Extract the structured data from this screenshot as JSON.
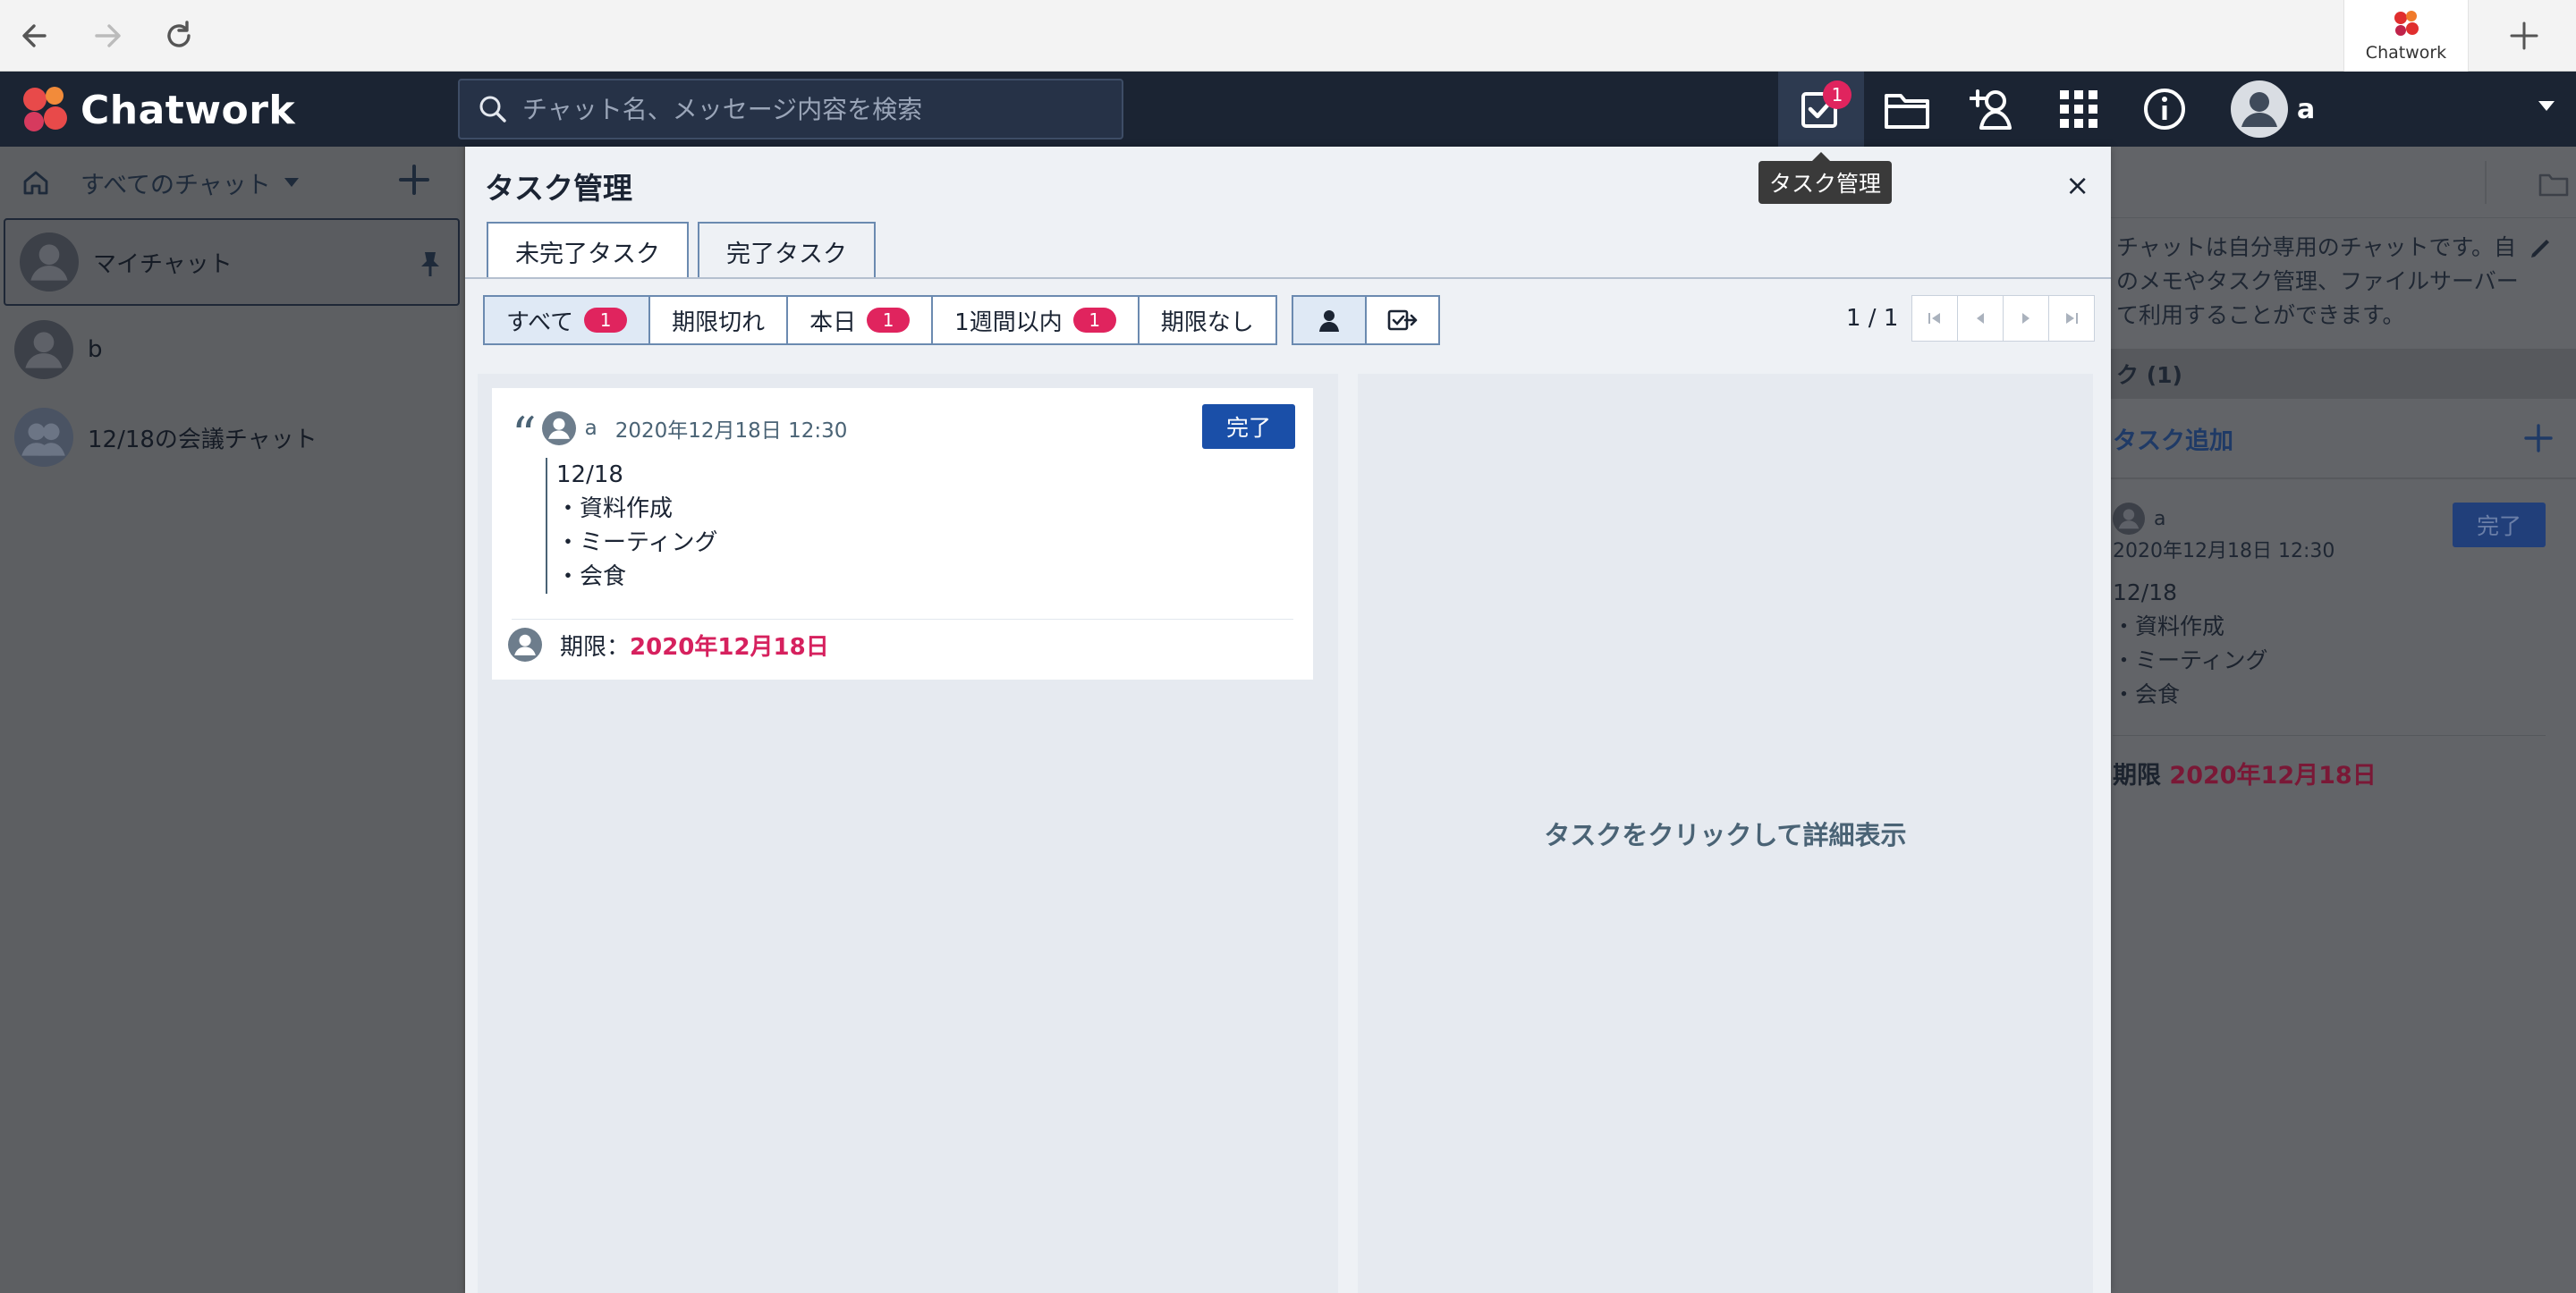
{
  "browser": {
    "tab_title": "Chatwork"
  },
  "header": {
    "logo_text": "Chatwork",
    "search_placeholder": "チャット名、メッセージ内容を検索",
    "task_badge": "1",
    "user_name": "a"
  },
  "tooltip": "タスク管理",
  "sidebar": {
    "filter_label": "すべてのチャット",
    "rooms": [
      {
        "name": "マイチャット"
      },
      {
        "name": "b"
      },
      {
        "name": "12/18の会議チャット"
      }
    ]
  },
  "right_panel": {
    "description": "チャットは自分専用のチャットです。自のメモやタスク管理、ファイルサーバーて利用することができます。",
    "desc_lines": [
      "チャットは自分専用のチャットです。自",
      "のメモやタスク管理、ファイルサーバー",
      "て利用することができます。"
    ],
    "section_title": "ク (1)",
    "add_task_label": "タスク追加",
    "task": {
      "user": "a",
      "time": "2020年12月18日 12:30",
      "done_label": "完了",
      "lines": [
        "12/18",
        "・資料作成",
        "・ミーティング",
        "・会食"
      ],
      "due_label": "期限",
      "due_date": "2020年12月18日"
    }
  },
  "modal": {
    "title": "タスク管理",
    "close": "×",
    "tabs": [
      {
        "label": "未完了タスク",
        "active": true
      },
      {
        "label": "完了タスク",
        "active": false
      }
    ],
    "filters": [
      {
        "label": "すべて",
        "count": "1"
      },
      {
        "label": "期限切れ",
        "count": ""
      },
      {
        "label": "本日",
        "count": "1"
      },
      {
        "label": "1週間以内",
        "count": "1"
      },
      {
        "label": "期限なし",
        "count": ""
      }
    ],
    "pager": "1 / 1",
    "detail_hint": "タスクをクリックして詳細表示",
    "task": {
      "user": "a",
      "time": "2020年12月18日 12:30",
      "done_label": "完了",
      "lines": [
        "12/18",
        "・資料作成",
        "・ミーティング",
        "・会食"
      ],
      "due_label": "期限：",
      "due_date": "2020年12月18日"
    }
  },
  "colors": {
    "header_bg": "#1b2433",
    "accent_blue": "#1a4fa8",
    "badge_red": "#e0245e",
    "due_red": "#d6215e"
  }
}
